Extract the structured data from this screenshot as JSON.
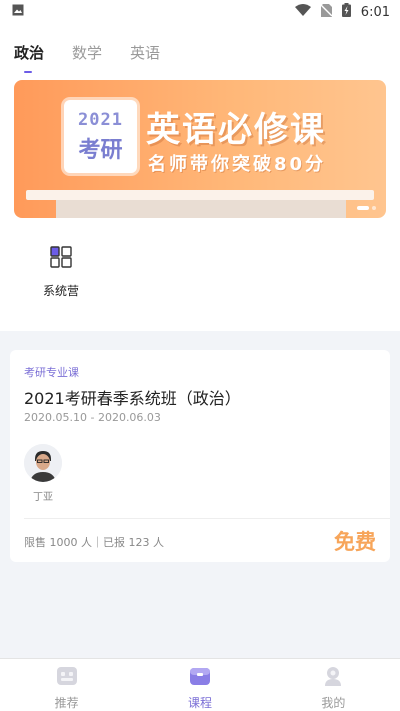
{
  "status_bar": {
    "time": "6:01"
  },
  "tabs": [
    {
      "label": "政治",
      "active": true
    },
    {
      "label": "数学",
      "active": false
    },
    {
      "label": "英语",
      "active": false
    }
  ],
  "banner": {
    "badge_year": "2021",
    "badge_text": "考研",
    "title": "英语必修课",
    "subtitle": "名师带你突破80分",
    "slide_count": 2,
    "active_slide": 1
  },
  "entries": [
    {
      "label": "系统营",
      "icon": "grid-icon"
    }
  ],
  "course": {
    "tag": "考研专业课",
    "title": "2021考研春季系统班（政治）",
    "dates": "2020.05.10 - 2020.06.03",
    "teacher": "丁亚",
    "sales": "限售 1000 人｜已报 123 人",
    "price": "免费"
  },
  "bottom_nav": [
    {
      "label": "推荐",
      "icon": "recommend-icon",
      "active": false
    },
    {
      "label": "课程",
      "icon": "course-icon",
      "active": true
    },
    {
      "label": "我的",
      "icon": "profile-icon",
      "active": false
    }
  ],
  "colors": {
    "accent": "#7b6fd6",
    "price": "#f7a55a",
    "banner": "#ff9a5a",
    "page_bg": "#f2f4f8"
  }
}
